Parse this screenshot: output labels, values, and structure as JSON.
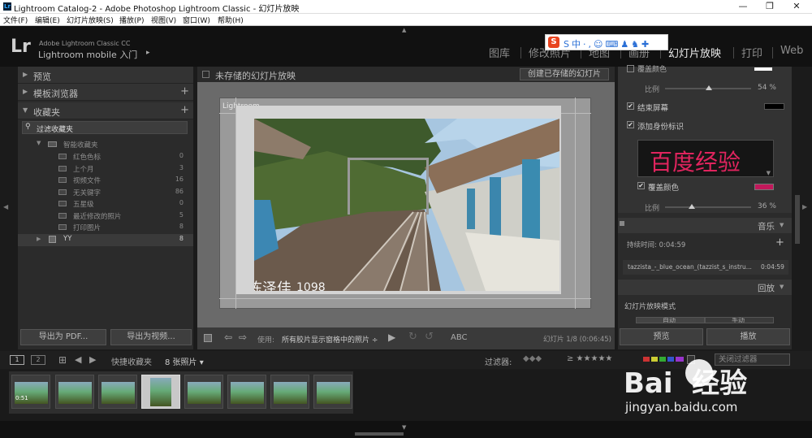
{
  "window": {
    "title": "Lightroom Catalog-2 - Adobe Photoshop Lightroom Classic - 幻灯片放映",
    "minimize": "—",
    "maximize": "❐",
    "close": "✕"
  },
  "menu": [
    "文件(F)",
    "编辑(E)",
    "幻灯片放映(S)",
    "播放(P)",
    "视图(V)",
    "窗口(W)",
    "帮助(H)"
  ],
  "identity": {
    "logo": "Lr",
    "product": "Adobe Lightroom Classic CC",
    "mobile": "Lightroom mobile 入门",
    "arrow": "▸"
  },
  "ime": {
    "label": "S中·,☺⌨♟♞✚"
  },
  "modules": [
    "图库",
    "修改照片",
    "地图",
    "画册",
    "幻灯片放映",
    "打印",
    "Web"
  ],
  "active_module": "幻灯片放映",
  "left": {
    "sections": [
      {
        "label": "预览"
      },
      {
        "label": "模板浏览器"
      },
      {
        "label": "收藏夹"
      }
    ],
    "filter_placeholder": "过滤收藏夹",
    "smart": "智能收藏夹",
    "items": [
      {
        "name": "红色色标",
        "count": "0"
      },
      {
        "name": "上个月",
        "count": "3"
      },
      {
        "name": "视频文件",
        "count": "16"
      },
      {
        "name": "无关键字",
        "count": "86"
      },
      {
        "name": "五星级",
        "count": "0"
      },
      {
        "name": "最近修改的照片",
        "count": "5"
      },
      {
        "name": "打印图片",
        "count": "8"
      }
    ],
    "collection": {
      "name": "YY",
      "count": "8"
    },
    "export_pdf": "导出为 PDF...",
    "export_video": "导出为视频..."
  },
  "center": {
    "title": "未存储的幻灯片放映",
    "create_btn": "创建已存储的幻灯片",
    "overlay_name": "陈泽佳",
    "overlay_num": "1098",
    "lightroom_tag": "Lightroom",
    "use_label": "使用:",
    "use_value": "所有胶片显示窗格中的照片 ÷",
    "abc": "ABC",
    "slide_info": "幻灯片 1/8 (0:06:45)"
  },
  "right": {
    "top_cut": "覆盖颜色",
    "ratio_label": "比例",
    "ratio1": "54 %",
    "end_screen": "结束屏幕",
    "add_identity": "添加身份标识",
    "identity_text": "百度经验",
    "overlay_color": "覆盖颜色",
    "ratio2": "36 %",
    "music_label": "音乐",
    "duration": "持续时间: 0:04:59",
    "track": "tazzista_-_blue_ocean_(tazzist_s_instru...",
    "track_time": "0:04:59",
    "playback_label": "回放",
    "mode_label": "幻灯片放映模式",
    "mode_a": "自动",
    "mode_b": "手动",
    "preview_btn": "预览",
    "play_btn": "播放",
    "identity_color": "#e0245e",
    "overlay_swatch": "#c2185b"
  },
  "filmtool": {
    "view1": "1",
    "view2": "2",
    "source": "快捷收藏夹",
    "count": "8 张照片 ▾",
    "filter_label": "过滤器:",
    "stars": "≥ ★★★★★",
    "filter_off": "关闭过滤器"
  },
  "thumbs": [
    {
      "label": "0:51"
    },
    {
      "label": ""
    },
    {
      "label": ""
    },
    {
      "label": ""
    },
    {
      "label": ""
    },
    {
      "label": ""
    },
    {
      "label": ""
    },
    {
      "label": ""
    }
  ],
  "watermark": {
    "brand": "Bai  经验",
    "url": "jingyan.baidu.com"
  },
  "colors": {
    "accent": "#e0e0e0",
    "brand": "#e3004f"
  }
}
